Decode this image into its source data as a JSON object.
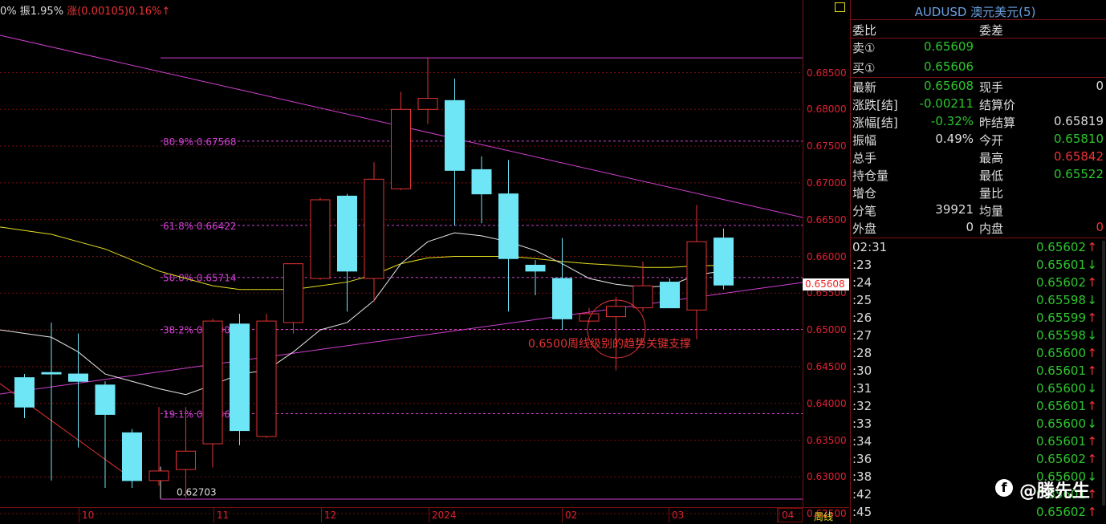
{
  "status": {
    "left_text": "0% 振1.95%",
    "right_text": "涨(0.00105)0.16%↑"
  },
  "chart_data": {
    "type": "candlestick",
    "symbol": "AUDUSD",
    "ylim": [
      0.6255,
      0.6905
    ],
    "y_ticks": [
      "0.68500",
      "0.68000",
      "0.67500",
      "0.67000",
      "0.66500",
      "0.66000",
      "0.65500",
      "0.65000",
      "0.64500",
      "0.64000",
      "0.63500",
      "0.63000",
      "0.62500"
    ],
    "x_ticks": [
      "10",
      "11",
      "12",
      "2024",
      "02",
      "03",
      "04"
    ],
    "period": "周线",
    "current_price": "0.65608",
    "candles": [
      {
        "o": 0.6435,
        "c": 0.6395,
        "h": 0.644,
        "l": 0.638
      },
      {
        "o": 0.6442,
        "c": 0.644,
        "h": 0.651,
        "l": 0.6295
      },
      {
        "o": 0.644,
        "c": 0.643,
        "h": 0.6495,
        "l": 0.634
      },
      {
        "o": 0.6425,
        "c": 0.6385,
        "h": 0.643,
        "l": 0.6285
      },
      {
        "o": 0.636,
        "c": 0.6295,
        "h": 0.6365,
        "l": 0.6285
      },
      {
        "o": 0.6295,
        "c": 0.6308,
        "h": 0.6395,
        "l": 0.6288
      },
      {
        "o": 0.631,
        "c": 0.6335,
        "h": 0.6395,
        "l": 0.6272
      },
      {
        "o": 0.6345,
        "c": 0.6512,
        "h": 0.6515,
        "l": 0.6313
      },
      {
        "o": 0.6508,
        "c": 0.6363,
        "h": 0.6522,
        "l": 0.6343
      },
      {
        "o": 0.6355,
        "c": 0.6512,
        "h": 0.6522,
        "l": 0.6353
      },
      {
        "o": 0.651,
        "c": 0.659,
        "h": 0.659,
        "l": 0.6495
      },
      {
        "o": 0.657,
        "c": 0.6677,
        "h": 0.668,
        "l": 0.6568
      },
      {
        "o": 0.6682,
        "c": 0.658,
        "h": 0.6685,
        "l": 0.6525
      },
      {
        "o": 0.657,
        "c": 0.6705,
        "h": 0.6728,
        "l": 0.6538
      },
      {
        "o": 0.6692,
        "c": 0.68,
        "h": 0.6824,
        "l": 0.669
      },
      {
        "o": 0.68,
        "c": 0.6815,
        "h": 0.687,
        "l": 0.678
      },
      {
        "o": 0.6812,
        "c": 0.6717,
        "h": 0.6842,
        "l": 0.6642
      },
      {
        "o": 0.6718,
        "c": 0.6685,
        "h": 0.6736,
        "l": 0.6645
      },
      {
        "o": 0.6685,
        "c": 0.6597,
        "h": 0.6731,
        "l": 0.6525
      },
      {
        "o": 0.6588,
        "c": 0.658,
        "h": 0.6595,
        "l": 0.6547
      },
      {
        "o": 0.657,
        "c": 0.6515,
        "h": 0.6625,
        "l": 0.65
      },
      {
        "o": 0.6512,
        "c": 0.6522,
        "h": 0.653,
        "l": 0.651
      },
      {
        "o": 0.6518,
        "c": 0.6532,
        "h": 0.6545,
        "l": 0.6445
      },
      {
        "o": 0.653,
        "c": 0.656,
        "h": 0.6593,
        "l": 0.6525
      },
      {
        "o": 0.6565,
        "c": 0.653,
        "h": 0.657,
        "l": 0.653
      },
      {
        "o": 0.6527,
        "c": 0.662,
        "h": 0.667,
        "l": 0.6487
      },
      {
        "o": 0.6625,
        "c": 0.6561,
        "h": 0.6638,
        "l": 0.6555
      }
    ],
    "fib_levels": [
      {
        "label": "80.9% 0.67568",
        "value": 0.67568
      },
      {
        "label": "61.8% 0.66422",
        "value": 0.66422
      },
      {
        "label": "50.0% 0.65714",
        "value": 0.65714
      },
      {
        "label": "38.2% 0.65006",
        "value": 0.65006
      },
      {
        "label": "19.1% 0.63860",
        "value": 0.6386
      }
    ],
    "high_marker": 0.687,
    "low_label": "0.62703",
    "low_value": 0.62703,
    "annotation": "0.6500周线级别的趋势关键支撑",
    "ma_short": [
      0.65,
      0.649,
      0.647,
      0.644,
      0.643,
      0.642,
      0.6412,
      0.6425,
      0.644,
      0.6445,
      0.647,
      0.65,
      0.651,
      0.654,
      0.659,
      0.662,
      0.6632,
      0.6628,
      0.662,
      0.6608,
      0.659,
      0.657,
      0.6562,
      0.6558,
      0.656,
      0.6575,
      0.658
    ],
    "ma_long": [
      0.664,
      0.663,
      0.662,
      0.661,
      0.6595,
      0.658,
      0.657,
      0.656,
      0.6555,
      0.6555,
      0.6555,
      0.656,
      0.6565,
      0.6575,
      0.659,
      0.6598,
      0.66,
      0.66,
      0.66,
      0.6597,
      0.6593,
      0.659,
      0.6588,
      0.6585,
      0.6585,
      0.6587,
      0.6588
    ]
  },
  "panel": {
    "title": "AUDUSD 澳元美元(5)",
    "rows": [
      {
        "l1": "委比",
        "v1": "",
        "l2": "委差",
        "v2": ""
      },
      {
        "l1": "卖①",
        "v1": "0.65609",
        "l2": "",
        "v2": ""
      },
      {
        "l1": "买①",
        "v1": "0.65606",
        "l2": "",
        "v2": ""
      },
      {
        "l1": "最新",
        "v1": "0.65608",
        "l2": "现手",
        "v2": "0"
      },
      {
        "l1": "涨跌[结]",
        "v1": "-0.00211",
        "l2": "结算价",
        "v2": ""
      },
      {
        "l1": "涨幅[结]",
        "v1": "-0.32%",
        "l2": "昨结算",
        "v2": "0.65819"
      },
      {
        "l1": "振幅",
        "v1": "0.49%",
        "l2": "今开",
        "v2": "0.65810"
      },
      {
        "l1": "总手",
        "v1": "",
        "l2": "最高",
        "v2": "0.65842"
      },
      {
        "l1": "持仓量",
        "v1": "",
        "l2": "最低",
        "v2": "0.65522"
      },
      {
        "l1": "增仓",
        "v1": "",
        "l2": "量比",
        "v2": ""
      },
      {
        "l1": "分笔",
        "v1": "39921",
        "l2": "均量",
        "v2": ""
      },
      {
        "l1": "外盘",
        "v1": "0",
        "l2": "内盘",
        "v2": "0"
      }
    ],
    "ticks": [
      {
        "t": "02:31",
        "p": "0.65602",
        "a": "↑"
      },
      {
        "t": ":23",
        "p": "0.65601",
        "a": "↓"
      },
      {
        "t": ":24",
        "p": "0.65602",
        "a": "↑"
      },
      {
        "t": ":25",
        "p": "0.65598",
        "a": "↓"
      },
      {
        "t": ":26",
        "p": "0.65599",
        "a": "↑"
      },
      {
        "t": ":27",
        "p": "0.65598",
        "a": "↓"
      },
      {
        "t": ":28",
        "p": "0.65600",
        "a": "↑"
      },
      {
        "t": ":30",
        "p": "0.65601",
        "a": "↑"
      },
      {
        "t": ":31",
        "p": "0.65600",
        "a": "↓"
      },
      {
        "t": ":32",
        "p": "0.65601",
        "a": "↑"
      },
      {
        "t": ":33",
        "p": "0.65600",
        "a": "↓"
      },
      {
        "t": ":34",
        "p": "0.65601",
        "a": "↑"
      },
      {
        "t": ":36",
        "p": "0.65602",
        "a": "↑"
      },
      {
        "t": ":38",
        "p": "0.65600",
        "a": "↓"
      },
      {
        "t": ":42",
        "p": "0.65601",
        "a": "↑"
      },
      {
        "t": ":45",
        "p": "0.65602",
        "a": "↑"
      }
    ]
  },
  "watermark": {
    "icon": "f",
    "text": "@滕先生"
  },
  "colors": {
    "up": "#e33333",
    "down": "#6fe6f6",
    "fib": "#d040d0",
    "trend": "#d040d0",
    "ma_short": "#e8e8e8",
    "ma_long": "#e8e020",
    "grid": "#7a1010",
    "annotation": "#e33333"
  }
}
